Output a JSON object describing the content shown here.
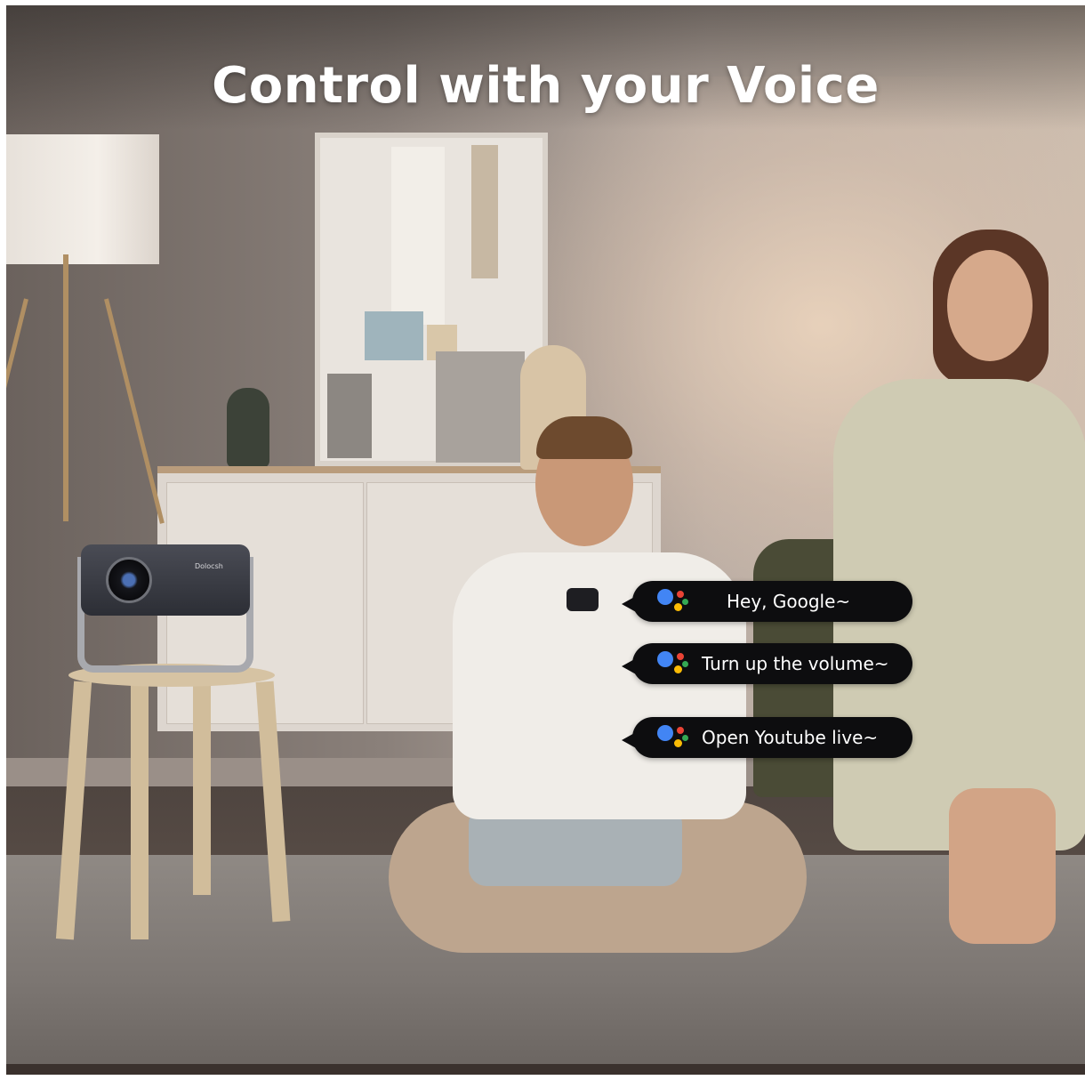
{
  "headline": "Control with your Voice",
  "projector_brand": "Dolocsh",
  "voice_commands": [
    {
      "text": "Hey, Google~",
      "icon": "google-assistant-icon"
    },
    {
      "text": "Turn up the volume~",
      "icon": "google-assistant-icon"
    },
    {
      "text": "Open Youtube live~",
      "icon": "google-assistant-icon"
    }
  ],
  "colors": {
    "assistant_blue": "#4285f4",
    "assistant_red": "#ea4335",
    "assistant_yellow": "#fbbc05",
    "assistant_green": "#34a853",
    "bubble_bg": "#0d0d0f"
  }
}
